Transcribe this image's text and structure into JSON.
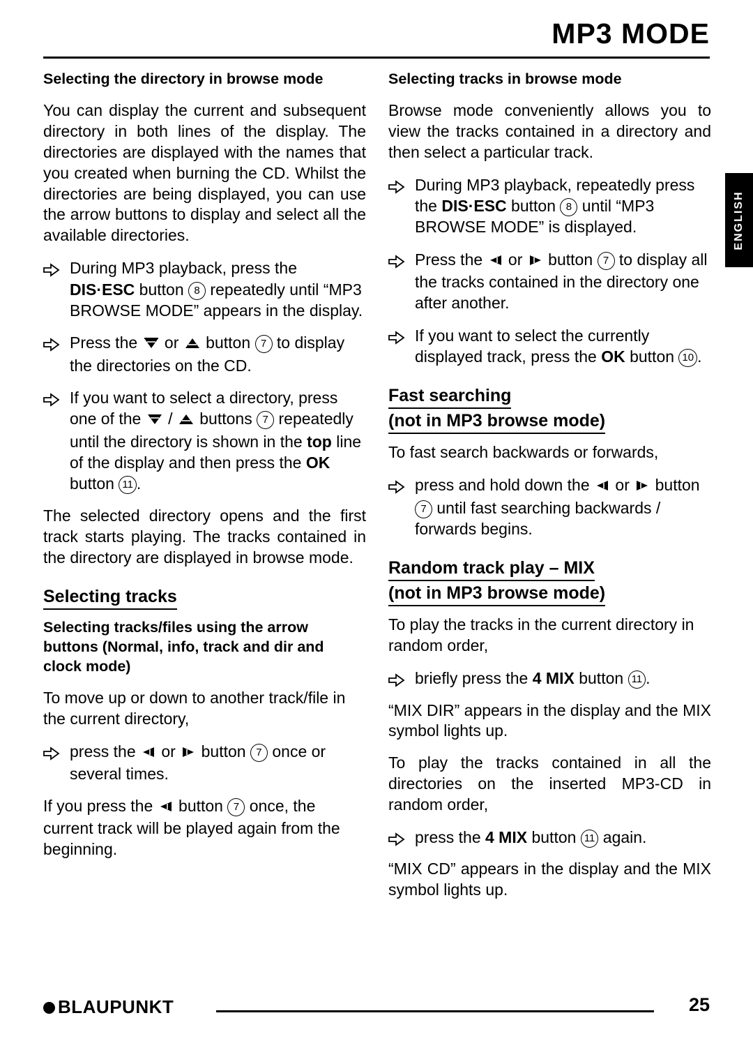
{
  "header": {
    "title": "MP3 MODE"
  },
  "side_tab": {
    "label": "ENGLISH"
  },
  "left_column": {
    "h1": "Selecting the directory in browse mode",
    "p1": "You can display the current and subsequent directory in both lines of the display. The directories are displayed with the names that you created when burning the CD. Whilst the directories are being displayed, you can use the arrow buttons to display and select all the available directories.",
    "b1_a": "During MP3 playback, press the ",
    "b1_b": "DIS·ESC",
    "b1_c": " button ",
    "b1_num": "8",
    "b1_d": " repeatedly until “MP3 BROWSE MODE” appears in the display.",
    "b2_a": "Press the ",
    "b2_b": " or ",
    "b2_c": " button ",
    "b2_num": "7",
    "b2_d": " to display the directories on the CD.",
    "b3_a": "If you want to select a directory, press one of the ",
    "b3_b": " / ",
    "b3_c": " buttons ",
    "b3_num": "7",
    "b3_d": " repeatedly until the directory is shown in the ",
    "b3_e": "top",
    "b3_f": " line of the display and then press the ",
    "b3_g": "OK",
    "b3_h": " button ",
    "b3_num2": "11",
    "b3_i": ".",
    "p2": "The selected directory opens and the first track starts playing. The tracks contained in the directory are displayed in browse mode.",
    "h2": "Selecting tracks",
    "h3": "Selecting tracks/files using the arrow buttons (Normal, info, track and dir and clock mode)",
    "p3": "To move up or down to another track/file in the current directory,",
    "b4_a": "press the ",
    "b4_b": " or ",
    "b4_c": " button ",
    "b4_num": "7",
    "b4_d": " once or several times.",
    "p4_a": "If you press the ",
    "p4_b": " button ",
    "p4_num": "7",
    "p4_c": " once, the current track will be played again from the beginning."
  },
  "right_column": {
    "h1": "Selecting tracks in browse mode",
    "p1": "Browse mode conveniently allows you to view the tracks contained in a directory and then select a particular track.",
    "b1_a": "During MP3 playback, repeatedly press the ",
    "b1_b": "DIS·ESC",
    "b1_c": " button ",
    "b1_num": "8",
    "b1_d": " until “MP3 BROWSE MODE” is displayed.",
    "b2_a": "Press the ",
    "b2_b": " or ",
    "b2_c": " button ",
    "b2_num": "7",
    "b2_d": " to display all the tracks contained in the directory one after another.",
    "b3_a": "If you want to select the currently displayed track, press the ",
    "b3_b": "OK",
    "b3_c": " button ",
    "b3_num": "10",
    "b3_d": ".",
    "h2_line1": "Fast searching",
    "h2_line2": "(not in MP3 browse mode)",
    "p2": "To fast search backwards or forwards,",
    "b4_a": "press and hold down the ",
    "b4_b": " or ",
    "b4_c": " button ",
    "b4_num": "7",
    "b4_d": " until fast searching backwards / forwards begins.",
    "h3_line1": "Random track play – MIX",
    "h3_line2": "(not in MP3 browse mode)",
    "p3": "To play the tracks in the current directory in random order,",
    "b5_a": "briefly press the ",
    "b5_b": "4 MIX",
    "b5_c": " button ",
    "b5_num": "11",
    "b5_d": ".",
    "p4": "“MIX DIR” appears in the display and the MIX symbol lights up.",
    "p5": "To play the tracks contained in all the directories on the inserted MP3-CD in random order,",
    "b6_a": "press the ",
    "b6_b": "4 MIX",
    "b6_c": " button ",
    "b6_num": "11",
    "b6_d": " again.",
    "p6": "“MIX CD” appears in the display and the MIX symbol lights up."
  },
  "footer": {
    "brand": "BLAUPUNKT",
    "page_number": "25"
  }
}
